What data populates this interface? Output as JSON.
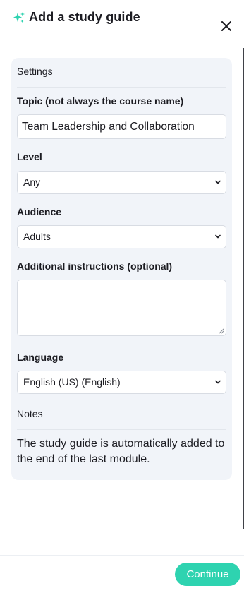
{
  "header": {
    "title": "Add a study guide",
    "icon": "sparkle-icon",
    "close_icon": "close-icon",
    "accent_color": "#2ed3b0"
  },
  "settings": {
    "section_title": "Settings",
    "topic": {
      "label": "Topic (not always the course name)",
      "value": "Team Leadership and Collaboration"
    },
    "level": {
      "label": "Level",
      "selected": "Any"
    },
    "audience": {
      "label": "Audience",
      "selected": "Adults"
    },
    "instructions": {
      "label": "Additional instructions (optional)",
      "value": ""
    },
    "language": {
      "label": "Language",
      "selected": "English (US) (English)"
    }
  },
  "notes": {
    "section_title": "Notes",
    "text": "The study guide is automatically added to the end of the last module."
  },
  "footer": {
    "continue_label": "Continue"
  }
}
